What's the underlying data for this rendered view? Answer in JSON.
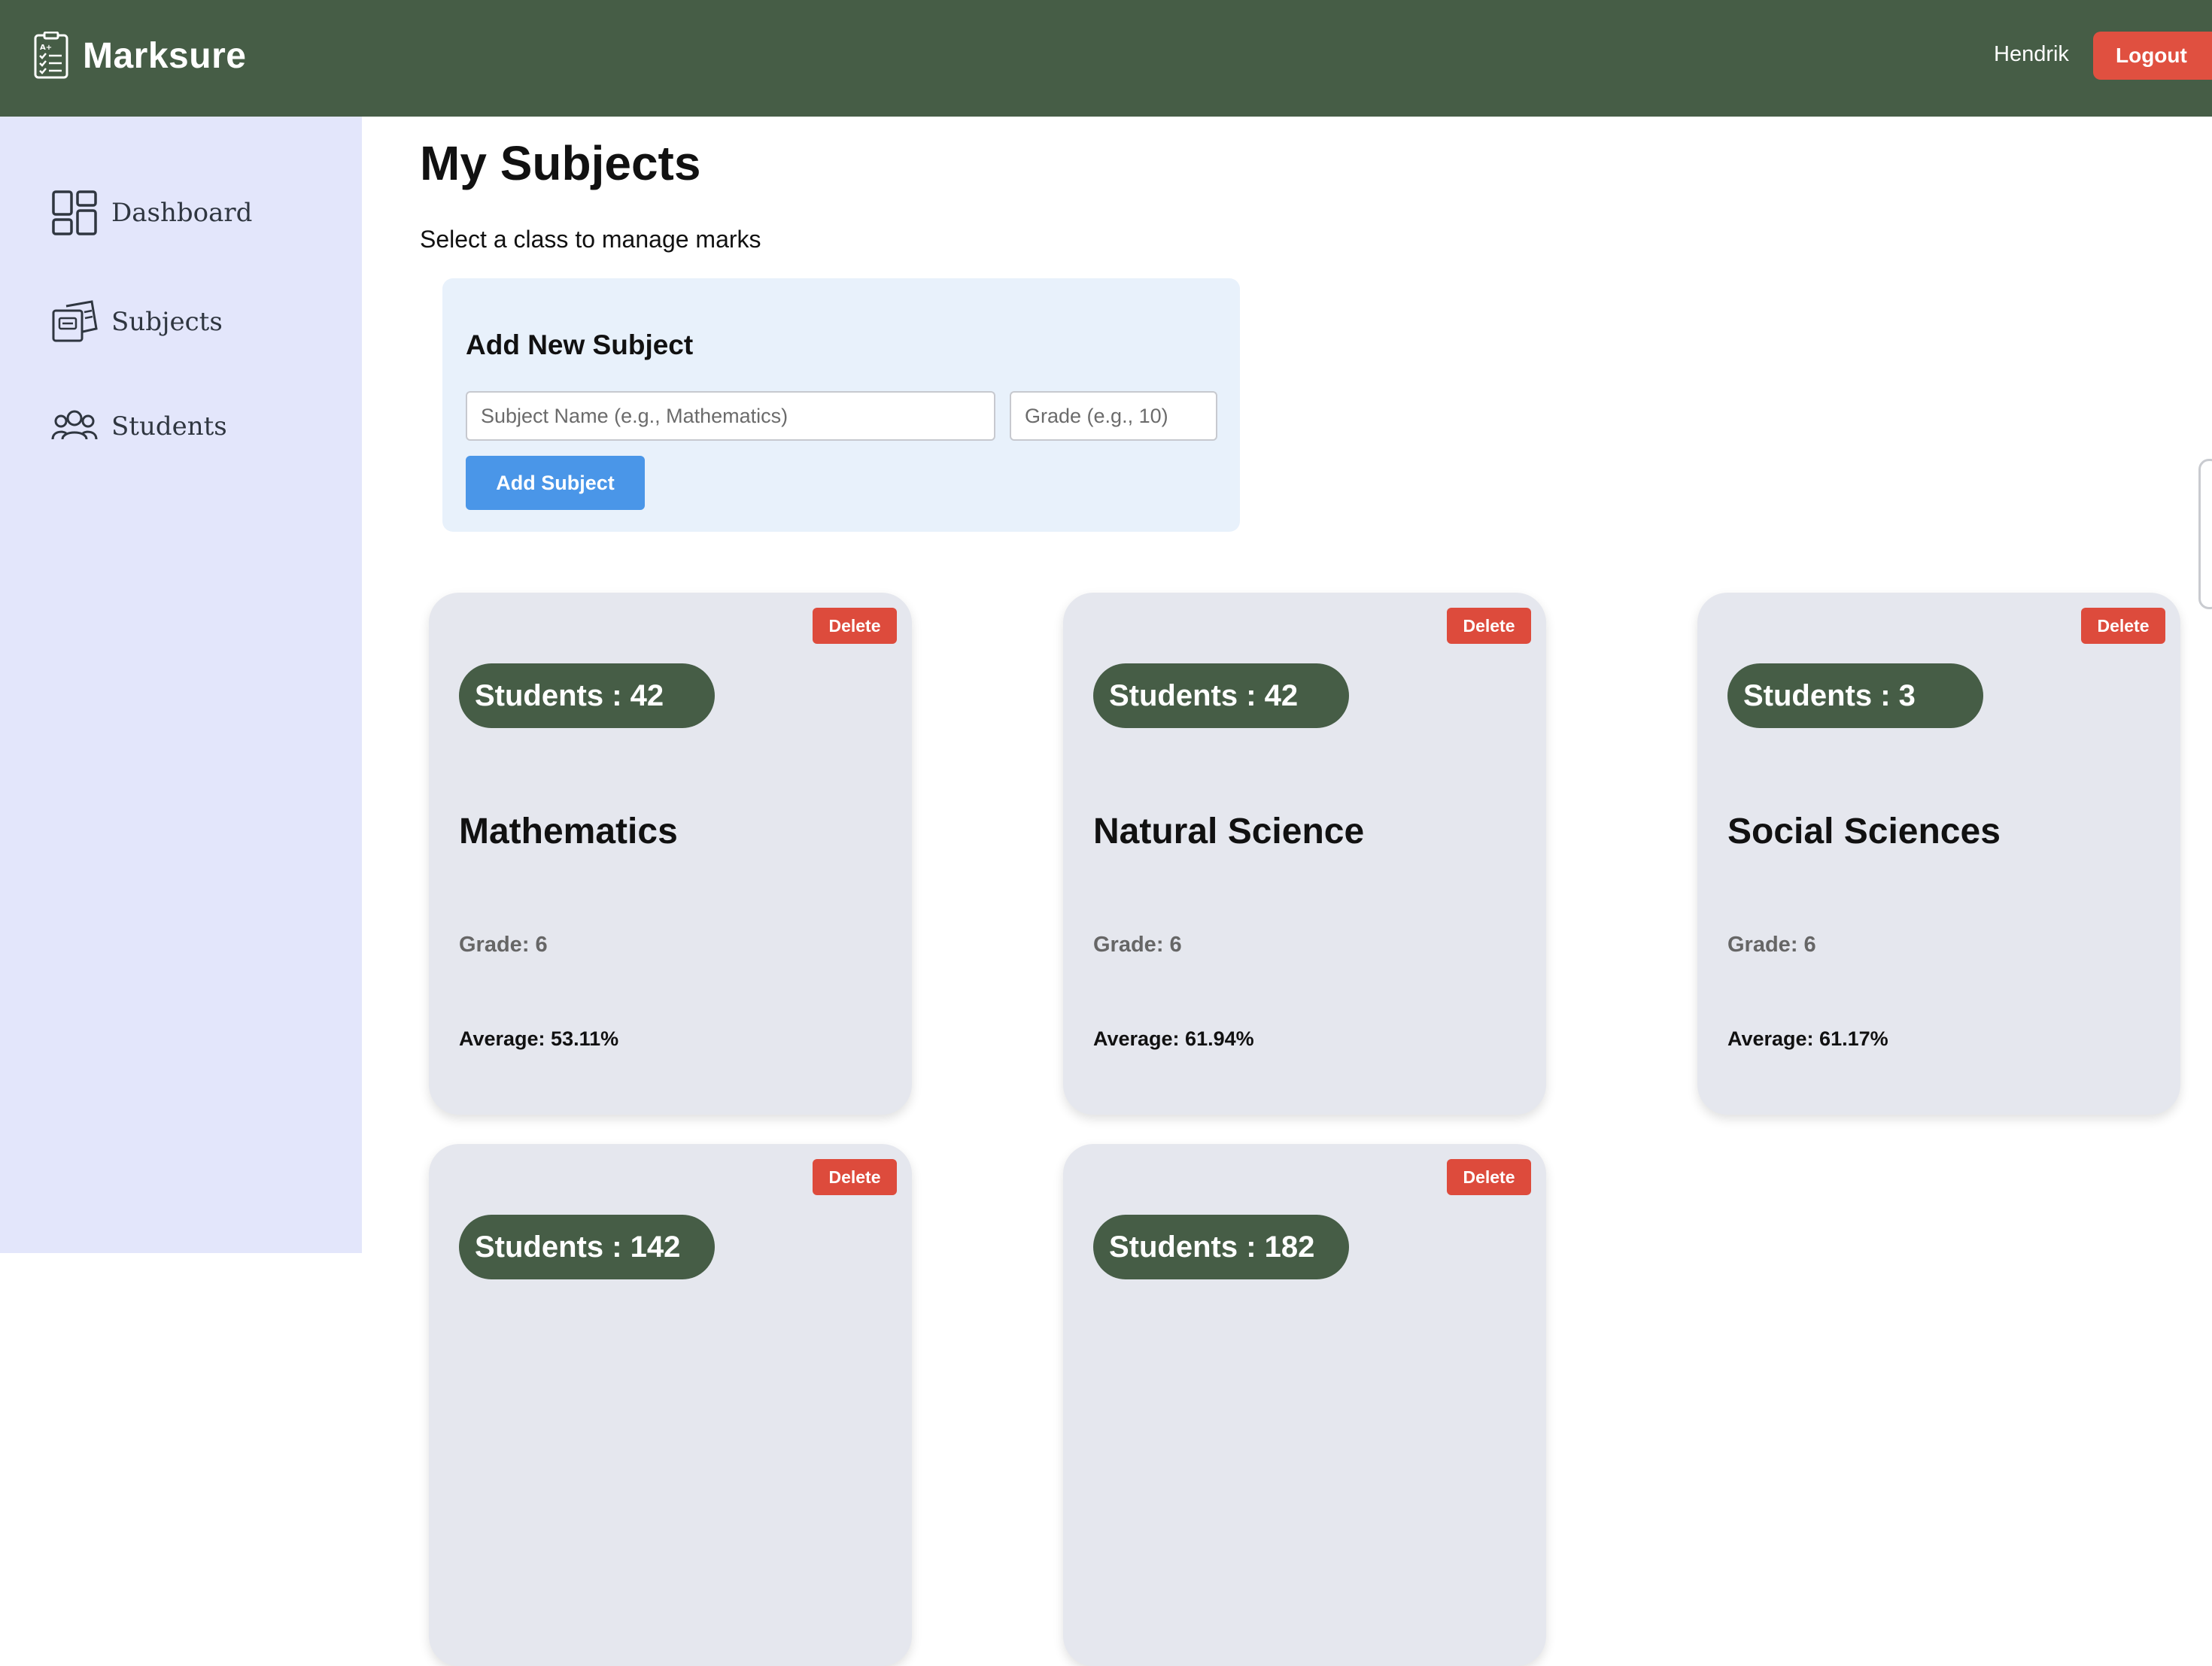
{
  "header": {
    "brand": "Marksure",
    "brand_icon": "clipboard-checklist-icon",
    "user": "Hendrik",
    "logout_label": "Logout"
  },
  "sidebar": {
    "items": [
      {
        "label": "Dashboard",
        "icon": "dashboard-grid-icon"
      },
      {
        "label": "Subjects",
        "icon": "subjects-books-icon"
      },
      {
        "label": "Students",
        "icon": "students-group-icon"
      }
    ]
  },
  "main": {
    "title": "My Subjects",
    "subtitle": "Select a class to manage marks"
  },
  "add_subject": {
    "title": "Add New Subject",
    "name_placeholder": "Subject Name (e.g., Mathematics)",
    "grade_placeholder": "Grade (e.g., 10)",
    "button_label": "Add Subject"
  },
  "cards": [
    {
      "delete_label": "Delete",
      "students": "Students : 42",
      "name": "Mathematics",
      "grade": "Grade: 6",
      "average": "Average: 53.11%"
    },
    {
      "delete_label": "Delete",
      "students": "Students : 42",
      "name": "Natural Science",
      "grade": "Grade: 6",
      "average": "Average: 61.94%"
    },
    {
      "delete_label": "Delete",
      "students": "Students : 3",
      "name": "Social Sciences",
      "grade": "Grade: 6",
      "average": "Average: 61.17%"
    },
    {
      "delete_label": "Delete",
      "students": "Students : 142"
    },
    {
      "delete_label": "Delete",
      "students": "Students : 182"
    }
  ],
  "colors": {
    "header_bg": "#465d46",
    "sidebar_bg": "#e3e6fb",
    "panel_bg": "#e8f1fb",
    "card_bg": "#e5e7ee",
    "accent_blue": "#4a96e8",
    "danger_red": "#dd4b3c"
  }
}
